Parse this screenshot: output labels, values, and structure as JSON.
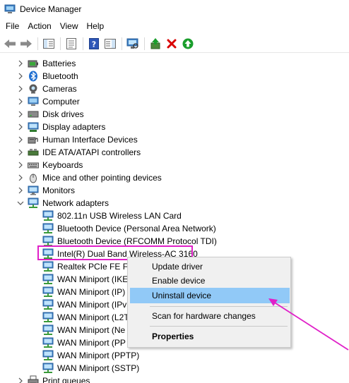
{
  "window": {
    "title": "Device Manager"
  },
  "menu": [
    "File",
    "Action",
    "View",
    "Help"
  ],
  "toolbar": [
    "back-icon",
    "forward-icon",
    "show-hide-console-tree-icon",
    "properties-icon",
    "help-icon",
    "action-pane-icon",
    "scan-hardware-changes-icon",
    "update-driver-icon",
    "uninstall-device-icon",
    "enable-device-icon"
  ],
  "tree": {
    "categories_before": [
      {
        "label": "Batteries",
        "icon": "battery-icon"
      },
      {
        "label": "Bluetooth",
        "icon": "bluetooth-icon"
      },
      {
        "label": "Cameras",
        "icon": "camera-icon"
      },
      {
        "label": "Computer",
        "icon": "computer-icon"
      },
      {
        "label": "Disk drives",
        "icon": "disk-drive-icon"
      },
      {
        "label": "Display adapters",
        "icon": "display-adapter-icon"
      },
      {
        "label": "Human Interface Devices",
        "icon": "hid-icon"
      },
      {
        "label": "IDE ATA/ATAPI controllers",
        "icon": "ide-controller-icon"
      },
      {
        "label": "Keyboards",
        "icon": "keyboard-icon"
      },
      {
        "label": "Mice and other pointing devices",
        "icon": "mouse-icon"
      },
      {
        "label": "Monitors",
        "icon": "monitor-icon"
      }
    ],
    "network": {
      "label": "Network adapters",
      "icon": "network-adapter-icon",
      "expanded": true,
      "children": [
        "802.11n USB Wireless LAN Card",
        "Bluetooth Device (Personal Area Network)",
        "Bluetooth Device (RFCOMM Protocol TDI)",
        "Intel(R) Dual Band Wireless-AC 3160",
        "Realtek PCIe FE Far",
        "WAN Miniport (IKE",
        "WAN Miniport (IP)",
        "WAN Miniport (IPv",
        "WAN Miniport (L2T",
        "WAN Miniport (Ne",
        "WAN Miniport (PP",
        "WAN Miniport (PPTP)",
        "WAN Miniport (SSTP)"
      ],
      "selected_index": 3
    },
    "categories_after": [
      {
        "label": "Print queues",
        "icon": "printer-icon"
      }
    ]
  },
  "context_menu": {
    "items": [
      {
        "label": "Update driver",
        "selected": false,
        "bold": false
      },
      {
        "label": "Enable device",
        "selected": false,
        "bold": false
      },
      {
        "label": "Uninstall device",
        "selected": true,
        "bold": false
      },
      {
        "label": "Scan for hardware changes",
        "selected": false,
        "bold": false
      },
      {
        "label": "Properties",
        "selected": false,
        "bold": true
      }
    ]
  },
  "colors": {
    "annotation": "#e020c8",
    "menu_highlight": "#91c9f7",
    "menu_background": "#f0f0f0",
    "uninstall_red": "#d90000",
    "enable_green": "#1a9e2c"
  }
}
